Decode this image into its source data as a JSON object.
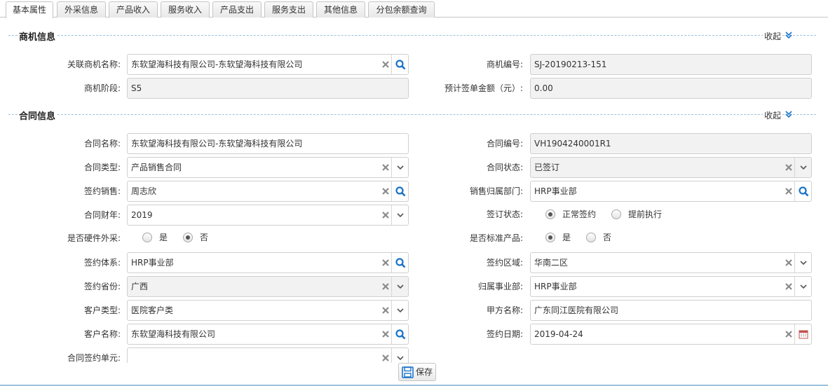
{
  "tabs": [
    {
      "label": "基本属性"
    },
    {
      "label": "外采信息"
    },
    {
      "label": "产品收入"
    },
    {
      "label": "服务收入"
    },
    {
      "label": "产品支出"
    },
    {
      "label": "服务支出"
    },
    {
      "label": "其他信息"
    },
    {
      "label": "分包余额查询"
    }
  ],
  "sections": {
    "opportunity": {
      "title": "商机信息",
      "collapse": "收起"
    },
    "contract": {
      "title": "合同信息",
      "collapse": "收起"
    }
  },
  "opportunity": {
    "related_name": {
      "label": "关联商机名称:",
      "value": "东软望海科技有限公司-东软望海科技有限公司"
    },
    "code": {
      "label": "商机编号:",
      "value": "SJ-20190213-151"
    },
    "stage": {
      "label": "商机阶段:",
      "value": "S5"
    },
    "expected_amount": {
      "label": "预计签单金额（元）:",
      "value": "0.00"
    }
  },
  "contract": {
    "name": {
      "label": "合同名称:",
      "value": "东软望海科技有限公司-东软望海科技有限公司"
    },
    "code": {
      "label": "合同编号:",
      "value": "VH1904240001R1"
    },
    "type": {
      "label": "合同类型:",
      "value": "产品销售合同"
    },
    "status": {
      "label": "合同状态:",
      "value": "已签订"
    },
    "sales": {
      "label": "签约销售:",
      "value": "周志欣"
    },
    "sales_dept": {
      "label": "销售归属部门:",
      "value": "HRP事业部"
    },
    "fiscal_year": {
      "label": "合同财年:",
      "value": "2019"
    },
    "sign_status": {
      "label": "签订状态:",
      "options": [
        "正常签约",
        "提前执行"
      ],
      "selected": "正常签约"
    },
    "hw_outsource": {
      "label": "是否硬件外采:",
      "options": [
        "是",
        "否"
      ],
      "selected": "否"
    },
    "std_product": {
      "label": "是否标准产品:",
      "options": [
        "是",
        "否"
      ],
      "selected": "是"
    },
    "sign_system": {
      "label": "签约体系:",
      "value": "HRP事业部"
    },
    "sign_region": {
      "label": "签约区域:",
      "value": "华南二区"
    },
    "sign_province": {
      "label": "签约省份:",
      "value": "广西"
    },
    "division": {
      "label": "归属事业部:",
      "value": "HRP事业部"
    },
    "customer_type": {
      "label": "客户类型:",
      "value": "医院客户类"
    },
    "party_a": {
      "label": "甲方名称:",
      "value": "广东同江医院有限公司"
    },
    "customer_name": {
      "label": "客户名称:",
      "value": "东软望海科技有限公司"
    },
    "sign_date": {
      "label": "签约日期:",
      "value": "2019-04-24"
    },
    "sign_unit": {
      "label": "合同签约单元:",
      "value": ""
    }
  },
  "footer": {
    "save_label": "保存"
  },
  "colors": {
    "accent_blue": "#1a73c7",
    "dash_line": "#9cc1dd",
    "readonly_bg": "#f2f2f2"
  }
}
